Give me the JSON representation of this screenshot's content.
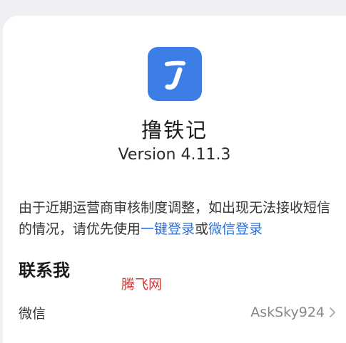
{
  "app": {
    "name": "撸铁记",
    "version": "Version 4.11.3",
    "icon_color": "#3d7de6"
  },
  "notice": {
    "text_part1": "由于近期运营商审核制度调整，如出现无法接收短信的情况，请优先使用",
    "link1": "一键登录",
    "text_part2": "或",
    "link2": "微信登录",
    "link_color": "#2f6fd6"
  },
  "contact": {
    "title": "联系我",
    "rows": [
      {
        "label": "微信",
        "value": "AskSky924",
        "icon": "chevron-right-icon"
      }
    ]
  },
  "watermark": "腾飞网"
}
